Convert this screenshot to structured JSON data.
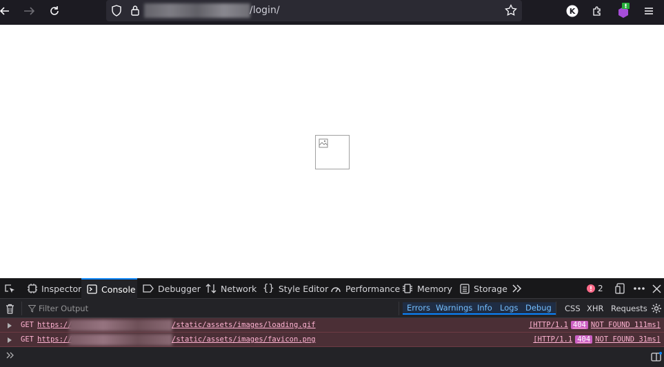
{
  "browser": {
    "url_path": "/login/"
  },
  "page": {
    "broken_image_alt": "broken-image"
  },
  "devtools": {
    "tabs": [
      {
        "label": "Inspector"
      },
      {
        "label": "Console"
      },
      {
        "label": "Debugger"
      },
      {
        "label": "Network"
      },
      {
        "label": "Style Editor"
      },
      {
        "label": "Performance"
      },
      {
        "label": "Memory"
      },
      {
        "label": "Storage"
      }
    ],
    "error_count": "2",
    "filter_placeholder": "Filter Output",
    "levels": [
      "Errors",
      "Warnings",
      "Info",
      "Logs",
      "Debug"
    ],
    "extra_filters": [
      "CSS",
      "XHR",
      "Requests"
    ],
    "messages": [
      {
        "method": "GET",
        "scheme": "https://",
        "path": "/static/assets/images/loading.gif",
        "protocol": "[HTTP/1.1",
        "code": "404",
        "reason": "NOT FOUND 111ms]"
      },
      {
        "method": "GET",
        "scheme": "https://",
        "path": "/static/assets/images/favicon.png",
        "protocol": "[HTTP/1.1",
        "code": "404",
        "reason": "NOT FOUND 31ms]"
      }
    ],
    "colors": {
      "accent": "#0a84ff",
      "error_row": "#4b2f36",
      "badge": "#cc60c4"
    }
  }
}
